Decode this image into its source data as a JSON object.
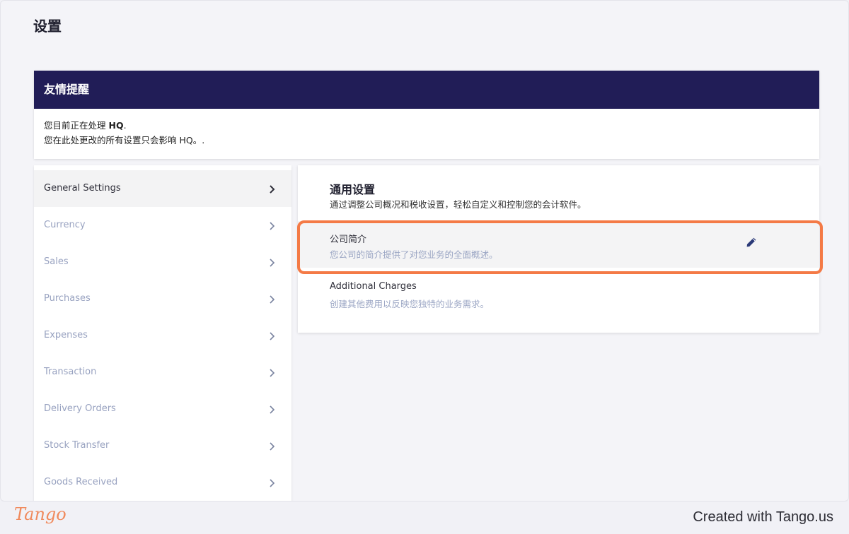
{
  "page": {
    "title": "设置"
  },
  "notice": {
    "header": "友情提醒",
    "line1_prefix": "您目前正在处理 ",
    "line1_bold": "HQ",
    "line1_suffix": ".",
    "line2": "您在此处更改的所有设置只会影响 HQ。."
  },
  "sidebar": {
    "items": [
      {
        "label": "General Settings",
        "active": true
      },
      {
        "label": "Currency"
      },
      {
        "label": "Sales"
      },
      {
        "label": "Purchases"
      },
      {
        "label": "Expenses"
      },
      {
        "label": "Transaction"
      },
      {
        "label": "Delivery Orders"
      },
      {
        "label": "Stock Transfer"
      },
      {
        "label": "Goods Received"
      }
    ]
  },
  "panel": {
    "title": "通用设置",
    "description": "通过调整公司概况和税收设置，轻松自定义和控制您的会计软件。",
    "rows": [
      {
        "title": "公司简介",
        "description": "您公司的简介提供了对您业务的全面概述。",
        "icon": "pencil-icon"
      },
      {
        "title": "Additional Charges",
        "description": "创建其他费用以反映您独特的业务需求。"
      }
    ]
  },
  "footer": {
    "logo": "Tango",
    "credit": "Created with Tango.us"
  },
  "colors": {
    "notice_header": "#211d57",
    "highlight": "#f47a46",
    "muted_text": "#98a2c0"
  }
}
